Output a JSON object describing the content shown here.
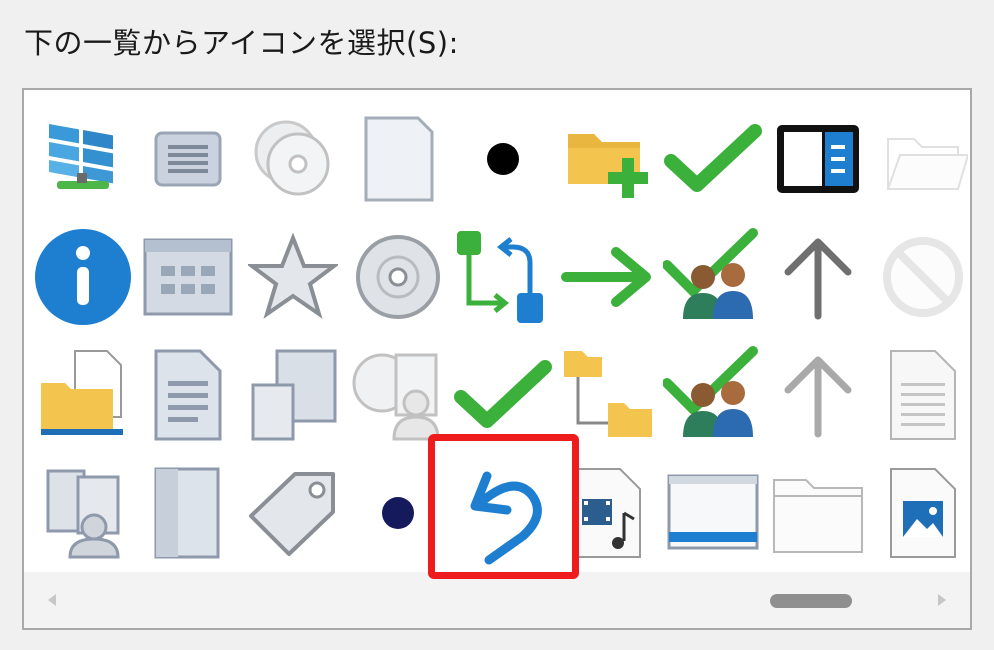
{
  "dialog": {
    "icon_list_label": "下の一覧からアイコンを選択(S):"
  },
  "colors": {
    "highlight": "#ee1c1c",
    "check_green": "#3bb03b",
    "accent_blue": "#1e7fd1",
    "folder_yellow": "#f3c44e"
  },
  "icon_list": {
    "rows": [
      [
        "windows-network-icon",
        "list-window-icon",
        "disc-stack-icon",
        "blank-page-icon",
        "black-dot-icon",
        "folder-add-icon",
        "green-check-icon",
        "sidebar-panel-icon",
        "open-folder-outline-icon"
      ],
      [
        "info-icon",
        "app-grid-window-icon",
        "star-icon",
        "cd-disc-icon",
        "flow-branch-icon",
        "green-arrow-right-icon",
        "users-check-icon",
        "arrow-up-icon",
        "blocked-icon"
      ],
      [
        "folder-document-icon",
        "text-document-icon",
        "windows-stack-icon",
        "disc-users-icon",
        "green-check-icon-2",
        "folder-tree-icon",
        "users-check-icon-2",
        "arrow-up-light-icon",
        "lined-document-icon"
      ],
      [
        "user-window-icon",
        "tall-window-icon",
        "tag-icon",
        "navy-dot-icon",
        "undo-icon",
        "video-music-file-icon",
        "window-taskbar-icon",
        "folder-outline-icon",
        "image-file-icon"
      ]
    ],
    "selected": "undo-icon"
  },
  "scrollbar": {
    "left_arrow": "◀",
    "right_arrow": "▶"
  }
}
